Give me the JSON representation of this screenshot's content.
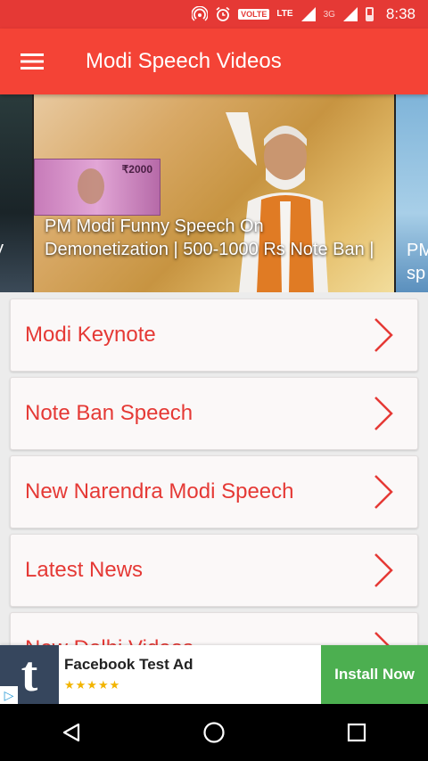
{
  "status_bar": {
    "time": "8:38",
    "volte": "VOLTE",
    "lte": "LTE",
    "net": "3G"
  },
  "app_bar": {
    "title": "Modi Speech Videos",
    "menu_icon": "hamburger-icon"
  },
  "carousel": {
    "left_caption": "y",
    "main_caption": "PM Modi Funny Speech On Demonetization | 500-1000 Rs Note Ban |",
    "right_caption_line1": "PM",
    "right_caption_line2": "sp",
    "note_value": "₹2000"
  },
  "menu": {
    "items": [
      {
        "label": "Modi Keynote"
      },
      {
        "label": "Note Ban Speech"
      },
      {
        "label": "New Narendra Modi Speech"
      },
      {
        "label": "Latest News"
      },
      {
        "label": "New Delhi Videos"
      }
    ]
  },
  "ad": {
    "logo_letter": "t",
    "title": "Facebook Test Ad",
    "stars": "★★★★★",
    "rating": 5,
    "cta": "Install Now",
    "adchoice": "▷"
  },
  "colors": {
    "primary": "#f44336",
    "status": "#e53935",
    "accent_text": "#e53935",
    "cta": "#4caf50"
  }
}
